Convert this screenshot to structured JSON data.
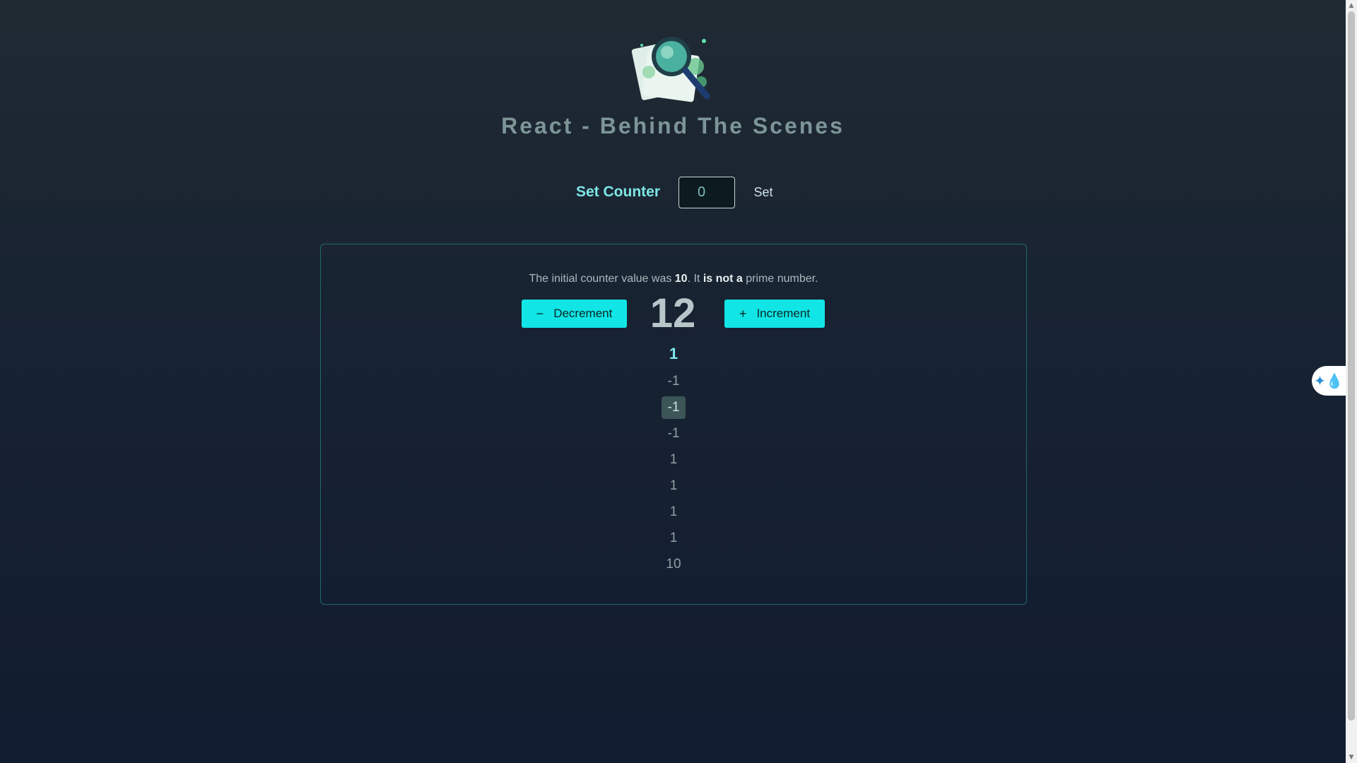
{
  "header": {
    "title": "React - Behind The Scenes",
    "logo_icon": "magnifying-glass-logo"
  },
  "set_counter": {
    "label": "Set Counter",
    "input_value": "0",
    "button_label": "Set"
  },
  "card": {
    "info_prefix": "The initial counter value was ",
    "initial_value": "10",
    "info_middle": ". It ",
    "prime_status": "is not a",
    "info_suffix": " prime number.",
    "decrement_label": "Decrement",
    "decrement_icon": "minus-icon",
    "increment_label": "Increment",
    "increment_icon": "plus-icon",
    "counter_value": "12",
    "history": [
      "1",
      "-1",
      "-1",
      "-1",
      "1",
      "1",
      "1",
      "1",
      "10"
    ],
    "highlighted_index": 2
  },
  "side_widget": {
    "icon": "droplet-sparkle-icon"
  },
  "colors": {
    "accent": "#11e5e5",
    "title": "#7d9597",
    "label": "#7ee6e6",
    "card_border": "#1e6a6e"
  }
}
